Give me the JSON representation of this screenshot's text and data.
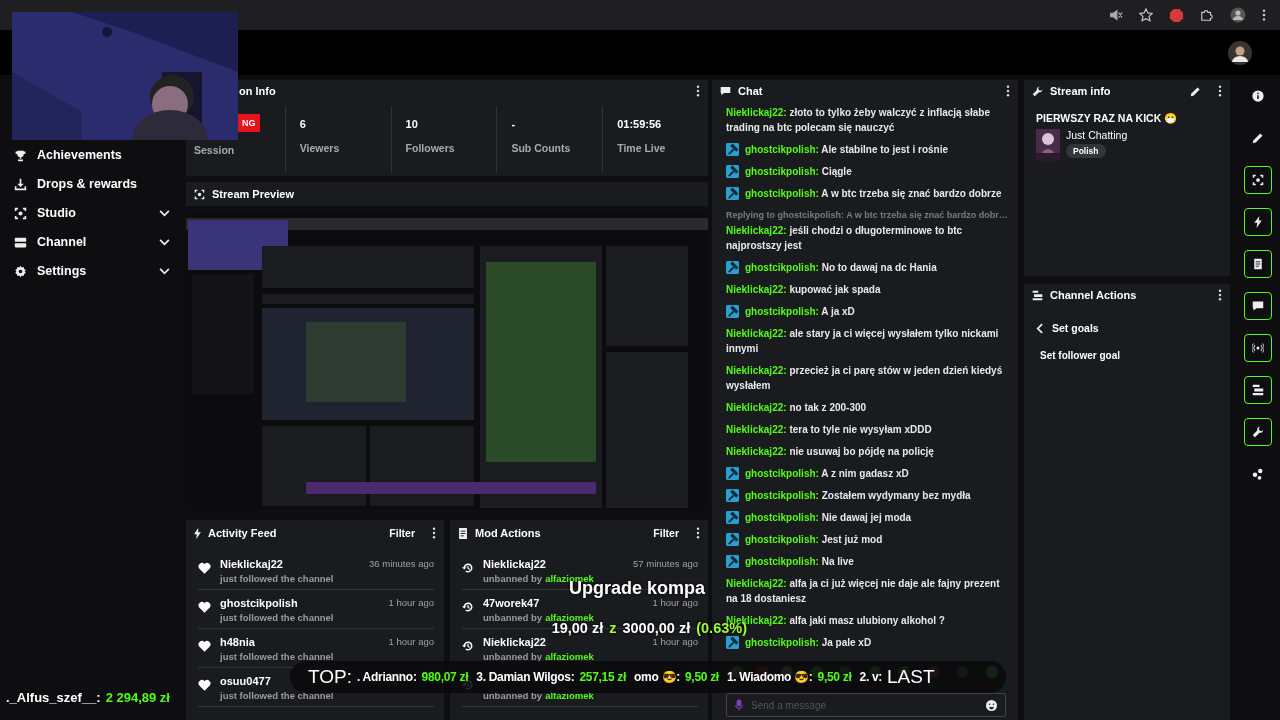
{
  "sidebar": {
    "items": [
      {
        "label": "Achievements",
        "expandable": false
      },
      {
        "label": "Drops & rewards",
        "expandable": false
      },
      {
        "label": "Studio",
        "expandable": true
      },
      {
        "label": "Channel",
        "expandable": true
      },
      {
        "label": "Settings",
        "expandable": true
      }
    ]
  },
  "session_info": {
    "title": "on Info",
    "badge": "NG",
    "stats": [
      {
        "label": "Session"
      },
      {
        "value": "6",
        "label": "Viewers"
      },
      {
        "value": "10",
        "label": "Followers"
      },
      {
        "value": "-",
        "label": "Sub Counts"
      },
      {
        "value": "01:59:56",
        "label": "Time Live"
      }
    ]
  },
  "stream_preview": {
    "title": "Stream Preview"
  },
  "activity_feed": {
    "title": "Activity Feed",
    "filter": "Filter",
    "items": [
      {
        "user": "Nieklickaj22",
        "time": "36 minutes ago",
        "text": "just followed the channel"
      },
      {
        "user": "ghostcikpolish",
        "time": "1 hour ago",
        "text": "just followed the channel"
      },
      {
        "user": "h48nia",
        "time": "1 hour ago",
        "text": "just followed the channel"
      },
      {
        "user": "osuu0477",
        "text": "just followed the channel"
      }
    ]
  },
  "mod_actions": {
    "title": "Mod Actions",
    "filter": "Filter",
    "items": [
      {
        "user": "Nieklickaj22",
        "time": "57 minutes ago",
        "action": "unbanned by",
        "moderator": "alfaziomek"
      },
      {
        "user": "47worek47",
        "time": "1 hour ago",
        "action": "unbanned by",
        "moderator": "alfaziomek"
      },
      {
        "user": "Nieklickaj22",
        "time": "1 hour ago",
        "action": "unbanned by",
        "moderator": "alfaziomek"
      },
      {
        "action": "unbanned by",
        "moderator": "alfaziomek"
      }
    ]
  },
  "chat": {
    "title": "Chat",
    "messages": [
      {
        "kind": "user",
        "user": "Nieklickaj22:",
        "text": "złoto to tylko żeby walczyć z inflacją słabe trading na btc polecam się nauczyć"
      },
      {
        "kind": "mod",
        "user": "ghostcikpolish:",
        "text": "Ale stabilne to jest i rośnie"
      },
      {
        "kind": "mod",
        "user": "ghostcikpolish:",
        "text": "Ciągle"
      },
      {
        "kind": "mod",
        "user": "ghostcikpolish:",
        "text": "A w btc trzeba się znać bardzo dobrze"
      },
      {
        "kind": "user",
        "reply": "Replying to ghostcikpolish: A w btc trzeba się znać bardzo dobr…",
        "user": "Nieklickaj22:",
        "text": "jeśli chodzi o długoterminowe to btc najprostszy jest"
      },
      {
        "kind": "mod",
        "user": "ghostcikpolish:",
        "text": "No to dawaj na dc Hania"
      },
      {
        "kind": "user",
        "user": "Nieklickaj22:",
        "text": "kupować jak spada"
      },
      {
        "kind": "mod",
        "user": "ghostcikpolish:",
        "text": "A ja xD"
      },
      {
        "kind": "user",
        "user": "Nieklickaj22:",
        "text": "ale stary ja ci więcej wysłałem tylko nickami innymi"
      },
      {
        "kind": "user",
        "user": "Nieklickaj22:",
        "text": "przecież ja ci parę stów w jeden dzień kiedyś wysłałem"
      },
      {
        "kind": "user",
        "user": "Nieklickaj22:",
        "text": "no tak z 200-300"
      },
      {
        "kind": "user",
        "user": "Nieklickaj22:",
        "text": "tera to tyle nie wysyłam xDDD"
      },
      {
        "kind": "user",
        "user": "Nieklickaj22:",
        "text": "nie usuwaj bo pójdę na policję"
      },
      {
        "kind": "mod",
        "user": "ghostcikpolish:",
        "text": "A z nim gadasz xD"
      },
      {
        "kind": "mod",
        "user": "ghostcikpolish:",
        "text": "Zostałem wydymany bez mydła"
      },
      {
        "kind": "mod",
        "user": "ghostcikpolish:",
        "text": "Nie dawaj jej moda"
      },
      {
        "kind": "mod",
        "user": "ghostcikpolish:",
        "text": "Jest już mod"
      },
      {
        "kind": "mod",
        "user": "ghostcikpolish:",
        "text": "Na live"
      },
      {
        "kind": "user",
        "user": "Nieklickaj22:",
        "text": "alfa ja ci już więcej nie daje ale fajny prezent na 18 dostaniesz"
      },
      {
        "kind": "user",
        "user": "Nieklickaj22:",
        "text": "alfa jaki masz ulubiony alkohol ?"
      },
      {
        "kind": "mod",
        "user": "ghostcikpolish:",
        "text": "Ja pale xD"
      }
    ],
    "input": {
      "placeholder": "Send a message"
    }
  },
  "stream_info": {
    "title": "Stream info",
    "stream_title": "PIERWSZY RAZ NA KICK 😷",
    "category": "Just Chatting",
    "tag": "Polish"
  },
  "channel_actions": {
    "title": "Channel Actions",
    "back": "Set goals",
    "items": [
      "Set follower goal"
    ]
  },
  "rail": {
    "buttons": [
      {
        "highlighted": false
      },
      {
        "highlighted": false
      },
      {
        "highlighted": true
      },
      {
        "highlighted": true
      },
      {
        "highlighted": true
      },
      {
        "highlighted": true
      },
      {
        "highlighted": true
      },
      {
        "highlighted": true
      },
      {
        "highlighted": true
      },
      {
        "highlighted": false
      }
    ]
  },
  "overlay": {
    "goal": {
      "title": "Upgrade kompa",
      "raised": "19,00 zł",
      "word": "z",
      "target": "3000,00 zł",
      "percent": "(0.63%)"
    },
    "ticker": {
      "label": "TOP:",
      "entries": [
        {
          "name": ". Adrianno:",
          "amount": "980,07 zł"
        },
        {
          "name": "3. Damian Wilgos:",
          "amount": "257,15 zł"
        },
        {
          "name": "omo 😎:",
          "amount": "9,50 zł"
        },
        {
          "name": "1. Wiadomo 😎:",
          "amount": "9,50 zł"
        },
        {
          "name": "2. v:"
        }
      ],
      "end": "LAST"
    },
    "top_donor": {
      "name": "._Alfus_szef__:",
      "amount": "2 294,89 zł"
    }
  }
}
